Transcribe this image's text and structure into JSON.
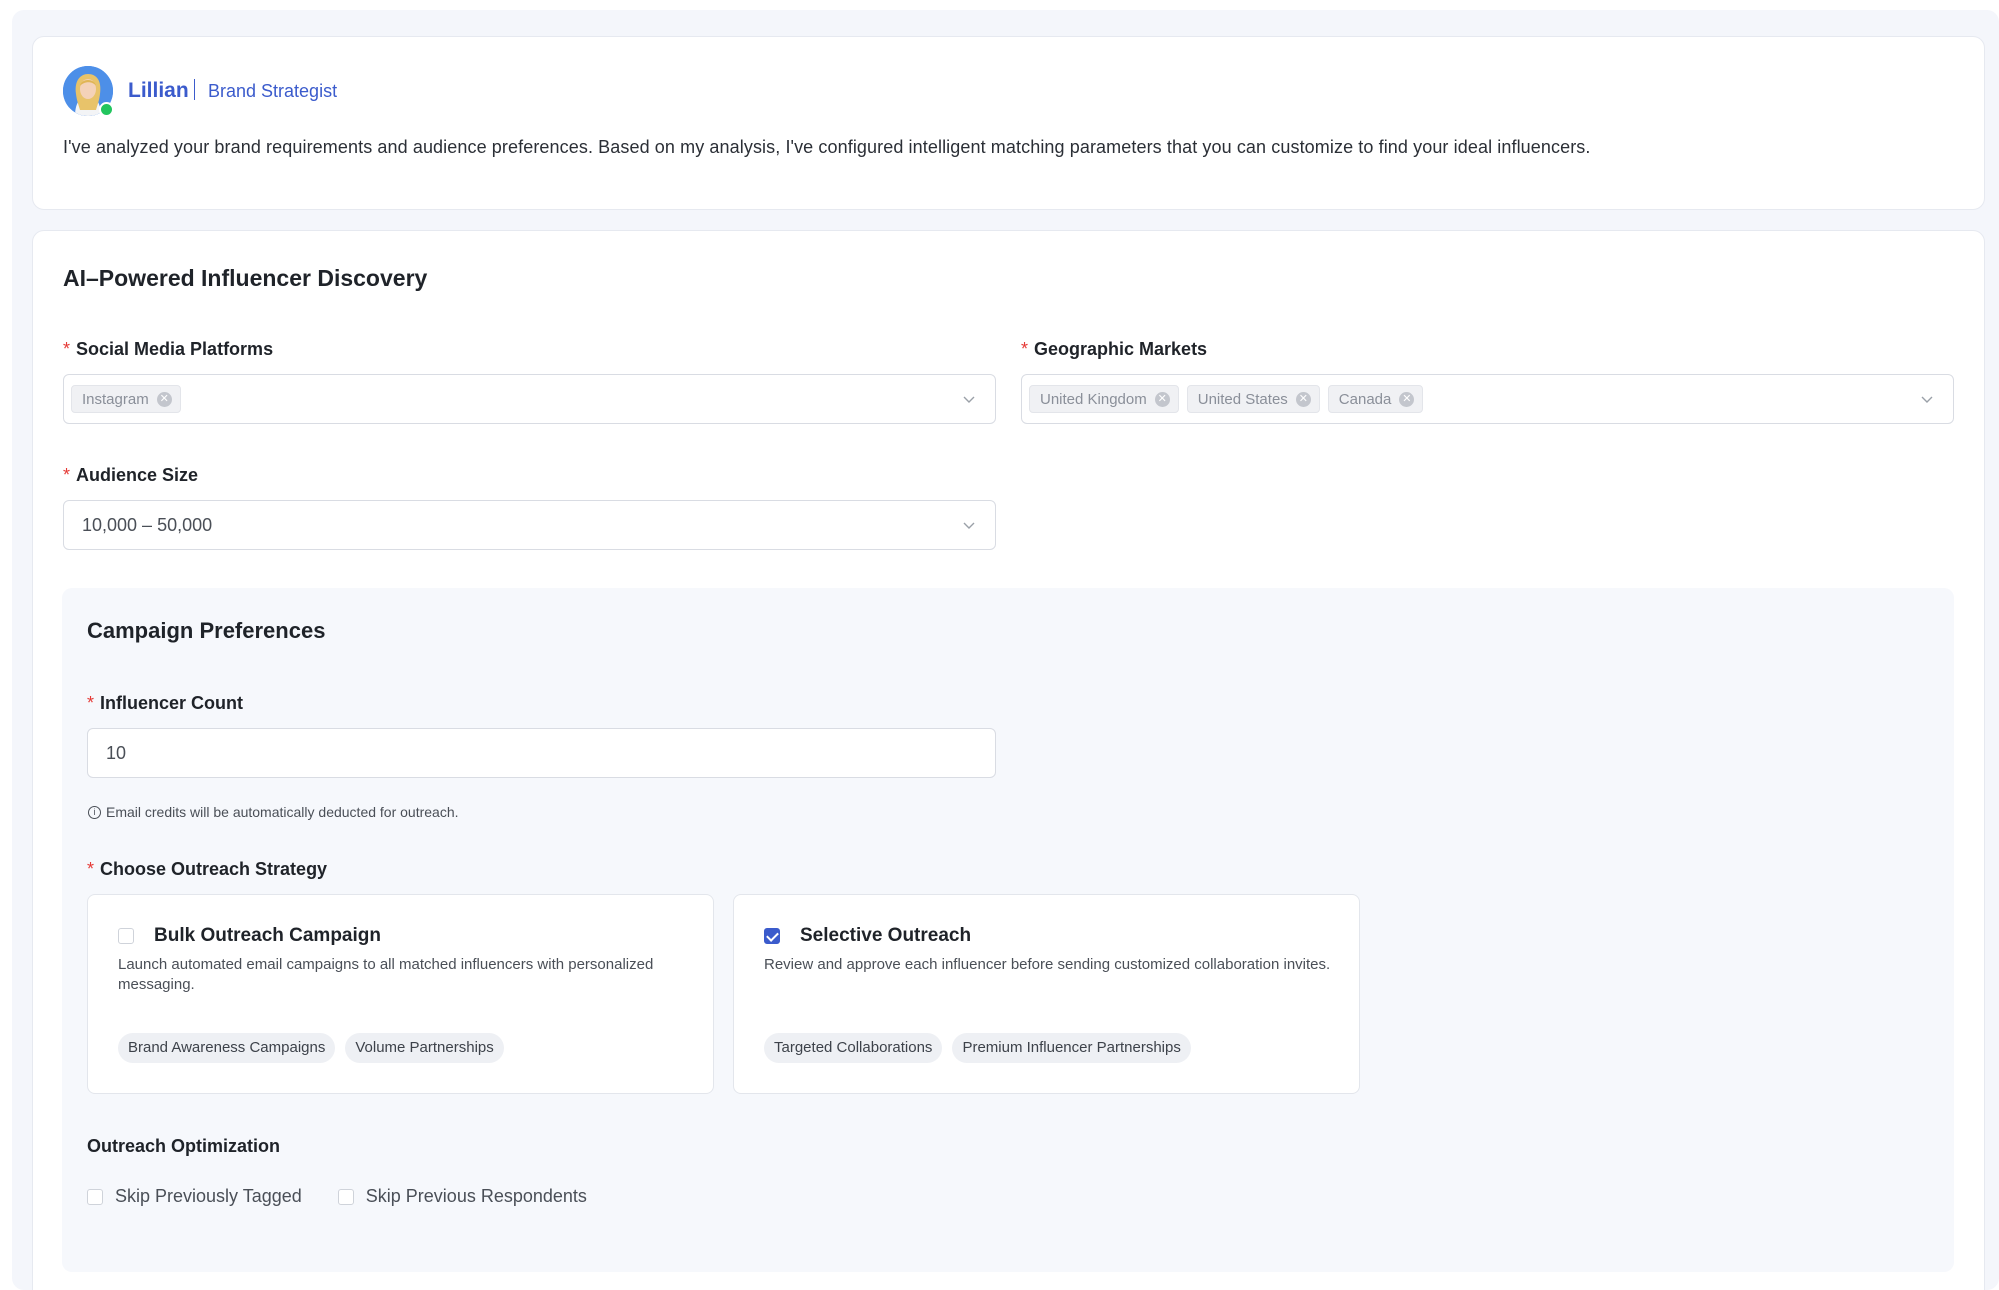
{
  "agent": {
    "name": "Lillian",
    "role": "Brand Strategist",
    "message": "I've analyzed your brand requirements and audience preferences. Based on my analysis, I've configured intelligent matching parameters that you can customize to find your ideal influencers."
  },
  "discovery": {
    "title": "AI–Powered Influencer Discovery",
    "platforms": {
      "label": "Social Media Platforms",
      "selected": [
        "Instagram"
      ]
    },
    "markets": {
      "label": "Geographic Markets",
      "selected": [
        "United Kingdom",
        "United States",
        "Canada"
      ]
    },
    "audience": {
      "label": "Audience Size",
      "value": "10,000 – 50,000"
    }
  },
  "campaign": {
    "title": "Campaign Preferences",
    "influencer_count": {
      "label": "Influencer Count",
      "value": "10",
      "hint": "Email credits will be automatically deducted for outreach."
    },
    "strategy": {
      "label": "Choose Outreach Strategy",
      "options": [
        {
          "title": "Bulk Outreach Campaign",
          "description": "Launch automated email campaigns to all matched influencers with personalized messaging.",
          "tags": [
            "Brand Awareness Campaigns",
            "Volume Partnerships"
          ],
          "checked": false
        },
        {
          "title": "Selective Outreach",
          "description": "Review and approve each influencer before sending customized collaboration invites.",
          "tags": [
            "Targeted Collaborations",
            "Premium Influencer Partnerships"
          ],
          "checked": true
        }
      ]
    },
    "optimization": {
      "label": "Outreach Optimization",
      "options": [
        {
          "label": "Skip Previously Tagged",
          "checked": false
        },
        {
          "label": "Skip Previous Respondents",
          "checked": false
        }
      ]
    }
  },
  "colors": {
    "accent": "#3b5bcc",
    "required": "#e53935",
    "online": "#22c55e"
  }
}
